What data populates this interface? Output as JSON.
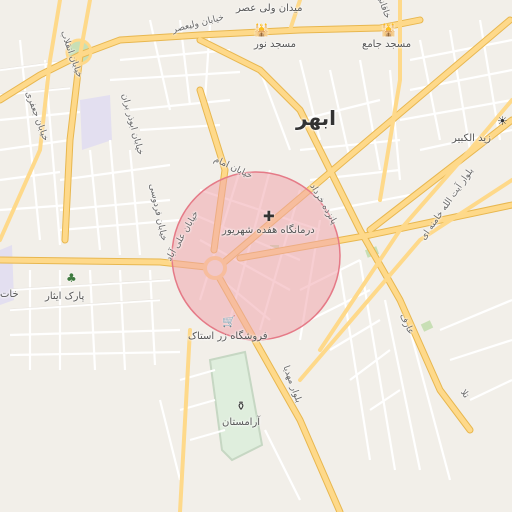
{
  "city": {
    "name": "ابهر"
  },
  "poi": {
    "clinic": "درمانگاه هفده شهریور",
    "store": "فروشگاه زر استاک",
    "park": "پارک ایثار",
    "cemetery": "آرامستان",
    "mosque_noor": "مسجد نور",
    "mosque_jame": "مسجد جامع",
    "square_valiasr": "میدان ولی عصر",
    "zeid": "زید الکبیر",
    "khat": "خات"
  },
  "streets": {
    "valiasr": "خیابان ولیعصر",
    "khaqani": "خاقانی",
    "enqelab": "خیابان انقلاب",
    "jafari": "خیابان جعفری",
    "abuzar": "خیابان ابوذر بران",
    "ferdowsi": "خیابان فردوسی",
    "aliabad": "خیابان علی آباد",
    "imam": "خیابان امام",
    "mahdi": "بلوار مهدیا",
    "khordad": "پانزده خرداد",
    "khamenei": "بلوار آیت الله خامنه ای",
    "aref": "عارف",
    "tall": "تلا"
  },
  "icons": {
    "clinic": "plus-icon",
    "store": "shopping-cart-icon",
    "park": "tree-icon",
    "cemetery": "cemetery-icon",
    "mosque": "mosque-icon",
    "memorial": "memorial-icon"
  },
  "colors": {
    "background": "#f2efe9",
    "major_road": "#fed98a",
    "minor_road": "#ffffff",
    "highlight_fill": "#f0a5ad",
    "highlight_stroke": "#e57a87",
    "park": "#c8dfb5"
  }
}
